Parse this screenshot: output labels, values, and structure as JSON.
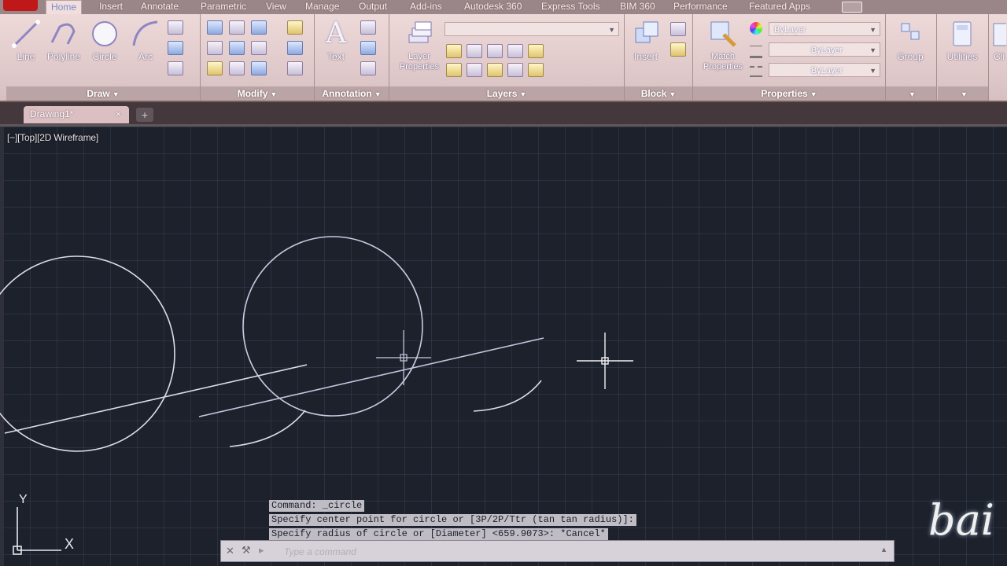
{
  "ribbon_tabs": [
    {
      "label": "Home",
      "active": true
    },
    {
      "label": "Insert"
    },
    {
      "label": "Annotate"
    },
    {
      "label": "Parametric"
    },
    {
      "label": "View"
    },
    {
      "label": "Manage"
    },
    {
      "label": "Output"
    },
    {
      "label": "Add-ins"
    },
    {
      "label": "Autodesk 360"
    },
    {
      "label": "Express Tools"
    },
    {
      "label": "BIM 360"
    },
    {
      "label": "Performance"
    },
    {
      "label": "Featured Apps"
    }
  ],
  "panels": {
    "draw": {
      "title": "Draw",
      "buttons": [
        "Line",
        "Polyline",
        "Circle",
        "Arc"
      ]
    },
    "modify": {
      "title": "Modify"
    },
    "annotation": {
      "title": "Annotation",
      "buttons": [
        "Text"
      ]
    },
    "layers": {
      "title": "Layers",
      "buttons": [
        "Layer Properties"
      ]
    },
    "block": {
      "title": "Block",
      "buttons": [
        "Insert"
      ]
    },
    "properties": {
      "title": "Properties",
      "buttons": [
        "Match Properties"
      ],
      "combos": [
        "ByLayer",
        "ByLayer",
        "ByLayer"
      ]
    },
    "groups": {
      "title": "",
      "buttons": [
        "Group"
      ]
    },
    "utilities": {
      "title": "",
      "buttons": [
        "Utilities"
      ]
    },
    "clipboard": {
      "buttons": [
        "Cli"
      ]
    }
  },
  "file_tab": {
    "label": "Drawing1*",
    "close": "×",
    "new_tab": "+"
  },
  "viewport": {
    "label": "[−][Top][2D Wireframe]"
  },
  "ucs": {
    "y_label": "Y",
    "x_label": "X"
  },
  "command_history": [
    "Command: _circle",
    "Specify center point for circle or [3P/2P/Ttr (tan tan radius)]:",
    "Specify radius of circle or [Diameter] <659.9073>: *Cancel*"
  ],
  "command_input": {
    "placeholder": "Type a command"
  },
  "watermark": {
    "text": "bai"
  },
  "colors": {
    "ribbon_bg": "#e6d0d1",
    "drawing_bg": "#1c212c",
    "geometry": "#dcdde8",
    "command_highlight": "#bfbcc4"
  }
}
